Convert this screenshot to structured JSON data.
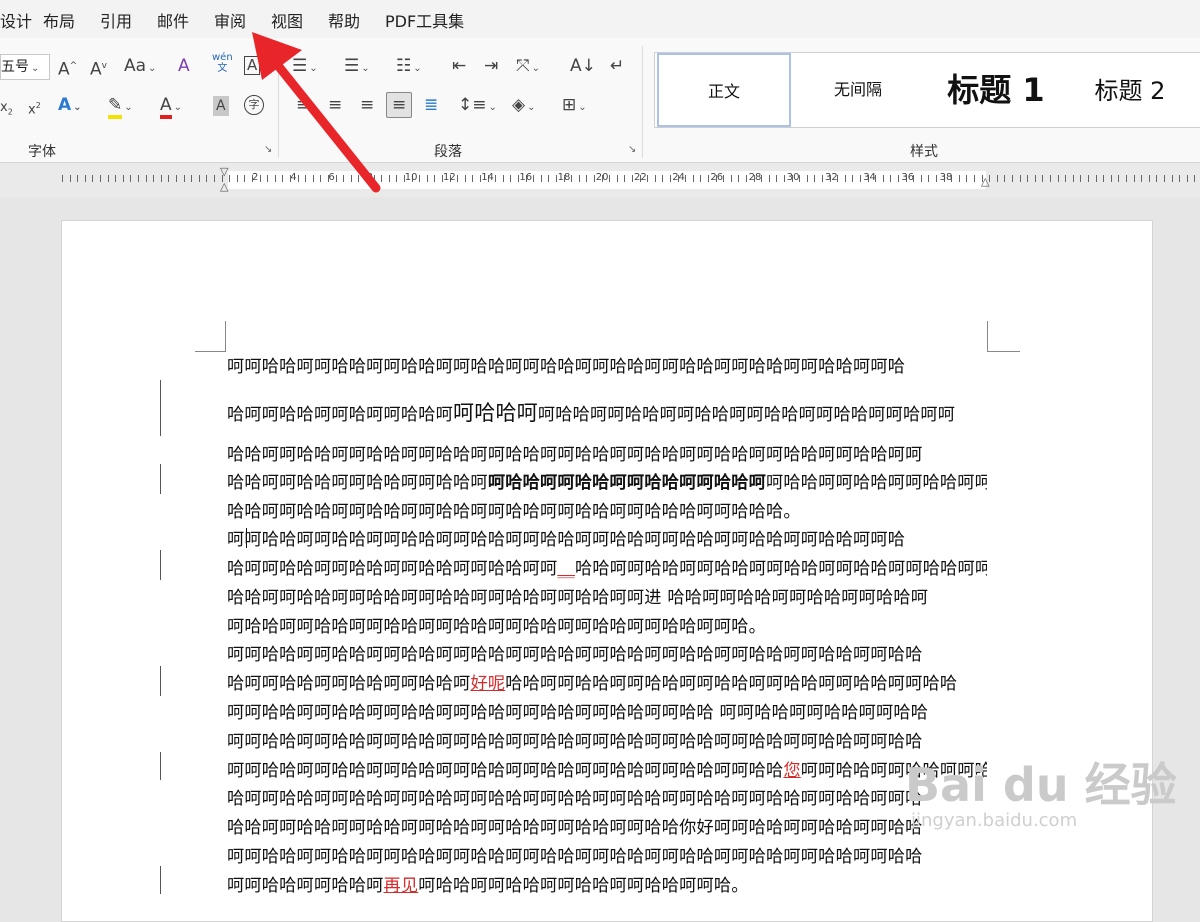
{
  "menu": [
    "设计",
    "布局",
    "引用",
    "邮件",
    "审阅",
    "视图",
    "帮助",
    "PDF工具集"
  ],
  "font_group": {
    "font_size": "五号",
    "label": "字体"
  },
  "paragraph_group": {
    "label": "段落"
  },
  "styles_group": {
    "label": "样式",
    "items": [
      "正文",
      "无间隔",
      "标题 1",
      "标题 2"
    ]
  },
  "ruler": {
    "numbers": [
      "2",
      "4",
      "6",
      "8",
      "10",
      "12",
      "14",
      "16",
      "18",
      "20",
      "22",
      "24",
      "26",
      "28",
      "30",
      "32",
      "34",
      "36",
      "38"
    ]
  },
  "document": {
    "lines": [
      {
        "parts": [
          {
            "t": "呵呵哈哈呵呵哈哈呵呵哈哈呵呵哈哈呵呵哈哈呵呵哈哈呵呵哈哈呵呵哈哈呵呵哈哈呵呵哈"
          }
        ]
      },
      {
        "parts": [
          {
            "t": "哈呵呵哈哈呵呵哈呵呵哈哈呵"
          },
          {
            "t": "呵哈哈呵",
            "s": "big"
          },
          {
            "t": "呵哈哈呵呵哈哈呵呵哈哈呵呵哈哈呵呵哈哈呵呵哈呵呵"
          }
        ]
      },
      {
        "parts": [
          {
            "t": "哈哈呵呵哈哈呵呵哈哈呵呵哈哈呵呵哈哈呵呵哈哈呵呵哈哈呵呵哈哈呵呵哈哈呵呵哈哈呵呵"
          }
        ]
      },
      {
        "parts": [
          {
            "t": "哈哈呵呵哈哈呵呵哈哈呵呵哈哈呵"
          },
          {
            "t": "呵哈哈呵呵哈哈呵呵哈哈呵呵哈哈呵",
            "s": "bold"
          },
          {
            "t": "呵哈哈呵呵哈哈呵呵哈哈呵呵"
          }
        ]
      },
      {
        "parts": [
          {
            "t": "哈哈呵呵哈哈呵呵哈哈呵呵哈哈呵呵哈哈呵呵哈哈呵呵哈哈哈呵呵哈哈哈。"
          }
        ]
      },
      {
        "parts": [
          {
            "t": "呵呵哈哈呵呵哈哈呵呵哈哈呵呵哈哈呵呵哈哈呵呵哈哈呵呵哈哈呵呵哈哈呵呵哈哈呵呵哈"
          }
        ]
      },
      {
        "parts": [
          {
            "t": "哈呵呵哈哈呵呵哈哈呵呵哈哈呵呵哈哈呵呵"
          },
          {
            "t": "__",
            "s": "red"
          },
          {
            "t": "哈哈呵呵哈哈呵呵哈哈呵呵哈哈呵呵哈哈呵呵哈哈呵呵"
          }
        ]
      },
      {
        "parts": [
          {
            "t": "哈哈呵呵哈哈呵呵哈哈呵呵哈哈呵呵哈哈呵呵哈哈呵呵进  哈哈呵呵哈哈呵呵哈哈呵呵哈哈呵"
          }
        ]
      },
      {
        "parts": [
          {
            "t": "呵哈哈呵呵哈哈呵呵哈哈呵呵哈哈呵呵哈哈呵呵哈哈呵呵哈哈呵呵哈。"
          }
        ]
      },
      {
        "parts": [
          {
            "t": "呵呵哈哈呵呵哈哈呵呵哈哈呵呵哈哈呵呵哈哈呵呵哈哈呵呵哈哈呵呵哈哈呵呵哈哈呵呵哈哈"
          }
        ]
      },
      {
        "parts": [
          {
            "t": "哈呵呵哈哈呵呵哈哈呵呵哈哈呵"
          },
          {
            "t": "好呢",
            "s": "red"
          },
          {
            "t": "哈哈呵呵哈哈呵呵哈哈呵呵哈哈呵呵哈哈呵呵哈哈呵呵哈哈"
          }
        ]
      },
      {
        "parts": [
          {
            "t": "呵呵哈哈呵呵哈哈呵呵哈哈呵呵哈哈呵呵哈哈呵呵哈哈呵呵哈哈    呵呵哈哈呵呵哈哈呵呵哈哈"
          }
        ]
      },
      {
        "parts": [
          {
            "t": "呵呵哈哈呵呵哈哈呵呵哈哈呵呵哈哈呵呵哈哈呵呵哈哈呵呵哈哈呵呵哈哈呵呵哈哈呵呵哈哈"
          }
        ]
      },
      {
        "parts": [
          {
            "t": "呵呵哈哈呵呵哈哈呵呵哈哈呵呵哈哈呵呵哈哈呵呵哈哈呵呵哈哈呵呵哈哈"
          },
          {
            "t": "您",
            "s": "red"
          },
          {
            "t": "呵呵哈哈呵呵哈哈呵呵哈哈"
          }
        ]
      },
      {
        "parts": [
          {
            "t": "哈呵呵哈哈呵呵哈哈呵呵哈哈呵呵哈哈呵呵哈哈呵呵哈哈呵呵哈哈呵呵哈哈呵呵哈哈呵呵哈"
          }
        ]
      },
      {
        "parts": [
          {
            "t": "哈哈呵呵哈哈呵呵哈哈呵呵哈哈呵呵哈哈呵呵哈哈呵呵哈哈你好呵呵哈哈呵呵哈哈呵呵哈哈"
          }
        ]
      },
      {
        "parts": [
          {
            "t": "呵呵哈哈呵呵哈哈呵呵哈哈呵呵哈哈呵呵哈哈呵呵哈哈呵呵哈哈呵呵哈哈呵呵哈哈呵呵哈哈"
          }
        ]
      },
      {
        "parts": [
          {
            "t": "呵呵哈哈呵呵哈哈呵"
          },
          {
            "t": "再见",
            "s": "red"
          },
          {
            "t": "呵哈哈呵呵哈哈呵呵哈哈呵呵哈哈呵呵哈。"
          }
        ]
      }
    ]
  },
  "watermark": {
    "brand": "Bai du 经验",
    "url": "jingyan.baidu.com"
  },
  "colors": {
    "accent_arrow": "#e8262a",
    "highlight": "#f3e200",
    "font_color": "#e02020",
    "change_mark": "#d62b2b"
  }
}
